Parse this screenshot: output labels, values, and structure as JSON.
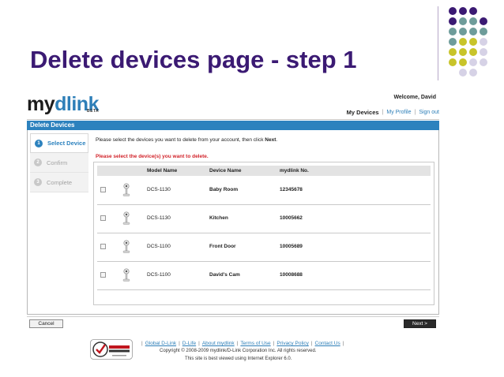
{
  "slide": {
    "title": "Delete devices page - step 1",
    "title_color": "#3b1a73"
  },
  "header": {
    "logo_my": "my",
    "logo_dlink": "dlink",
    "logo_beta": "BETA",
    "welcome": "Welcome, David",
    "nav_current": "My Devices",
    "nav_profile": "My Profile",
    "nav_signout": "Sign out"
  },
  "panel": {
    "title": "Delete Devices",
    "accent": "#2c82be"
  },
  "steps": [
    {
      "num": "1",
      "label": "Select Device"
    },
    {
      "num": "2",
      "label": "Confirm"
    },
    {
      "num": "3",
      "label": "Complete"
    }
  ],
  "instruction": {
    "text": "Please select the devices you want to delete from your account, then click",
    "bold": "Next",
    "end": "."
  },
  "warning": "Please select the device(s) you want to delete.",
  "table": {
    "headers": {
      "model": "Model Name",
      "name": "Device Name",
      "number": "mydlink No."
    },
    "rows": [
      {
        "model": "DCS-1130",
        "name": "Baby Room",
        "number": "12345678"
      },
      {
        "model": "DCS-1130",
        "name": "Kitchen",
        "number": "10005662"
      },
      {
        "model": "DCS-1100",
        "name": "Front Door",
        "number": "10005689"
      },
      {
        "model": "DCS-1100",
        "name": "David's Cam",
        "number": "10008688"
      }
    ]
  },
  "buttons": {
    "cancel": "Cancel",
    "next": "Next >"
  },
  "footer": {
    "links": [
      "Global D-Link",
      "D-Life",
      "About mydlink",
      "Terms of Use",
      "Privacy Policy",
      "Contact Us"
    ],
    "copyright": "Copyright © 2008-2009 mydlink/D-Link Corporation Inc. All rights reserved.",
    "best_viewed": "This site is best viewed using Internet Explorer 6.0."
  },
  "icons": {
    "camera": "camera-icon",
    "verisign": "verisign-secured-logo",
    "checkbox": "checkbox"
  },
  "colors": {
    "link": "#2e7fb8",
    "warning": "#d2232a",
    "dot_purple": "#3b1a73",
    "dot_teal": "#6e9c9a",
    "dot_yellow": "#c8c42a",
    "dot_lilac": "#d6d2e6"
  }
}
